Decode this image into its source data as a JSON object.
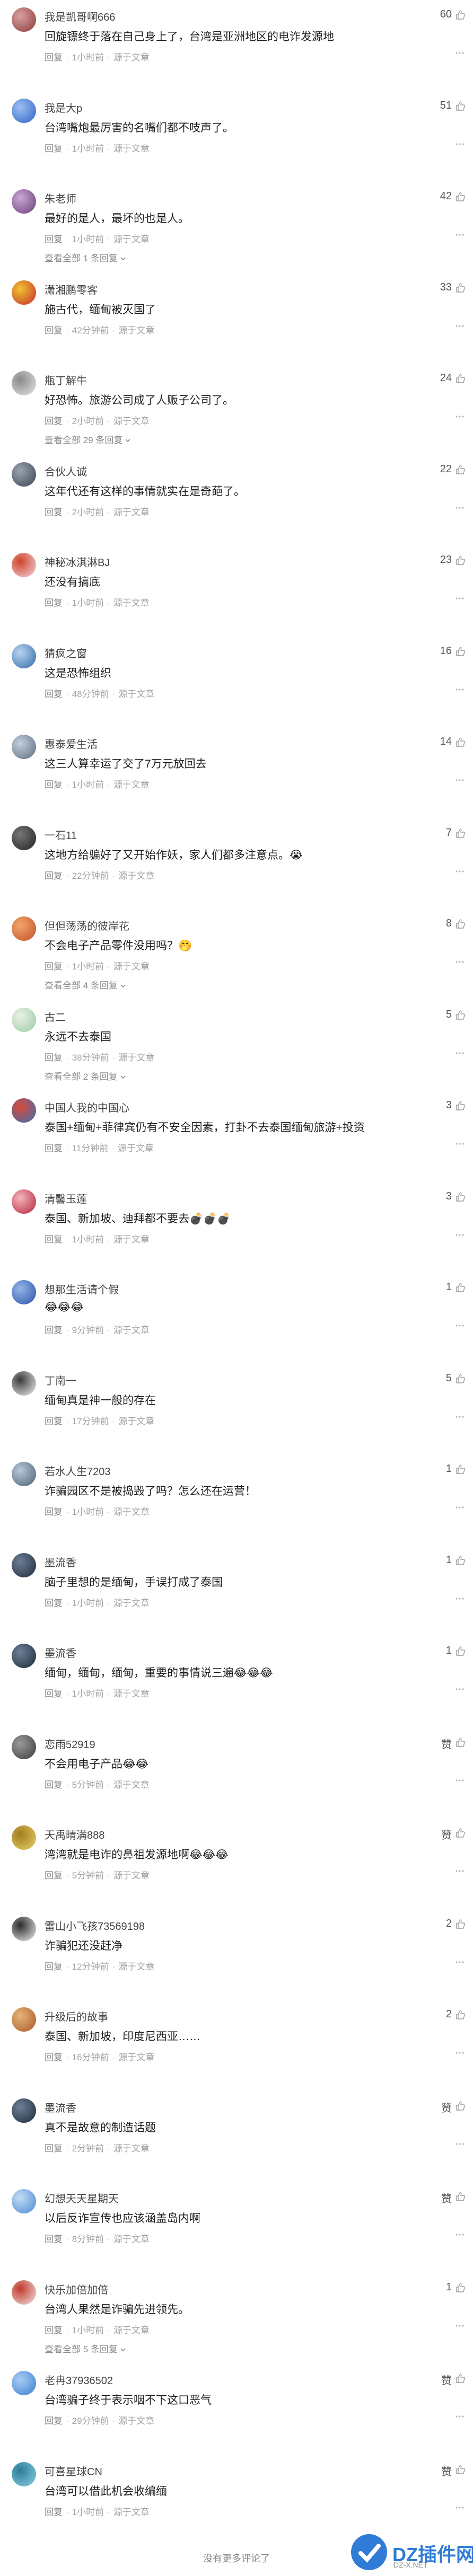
{
  "comments": [
    {
      "name": "我是凯哥啊666",
      "text": "回旋镖终于落在自己身上了，台湾是亚洲地区的电诈发源地",
      "time": "1小时前",
      "source": "源于文章",
      "likes": "60",
      "sub": "",
      "colors": [
        "#8b3a3a",
        "#d9a0a0"
      ]
    },
    {
      "name": "我是大p",
      "text": "台湾嘴炮最厉害的名嘴们都不吱声了。",
      "time": "1小时前",
      "source": "源于文章",
      "likes": "51",
      "sub": "",
      "colors": [
        "#2f63c8",
        "#9cc0f2"
      ]
    },
    {
      "name": "朱老师",
      "text": "最好的是人，最坏的也是人。",
      "time": "1小时前",
      "source": "源于文章",
      "likes": "42",
      "sub": "查看全部 1 条回复",
      "colors": [
        "#6b3f78",
        "#c9a7d6"
      ]
    },
    {
      "name": "潇湘鹏零客",
      "text": "施古代，缅甸被灭国了",
      "time": "42分钟前",
      "source": "源于文章",
      "likes": "33",
      "sub": "",
      "colors": [
        "#c62d2d",
        "#f1c232"
      ]
    },
    {
      "name": "瓶丁解牛",
      "text": "好恐怖。旅游公司成了人贩子公司了。",
      "time": "2小时前",
      "source": "源于文章",
      "likes": "24",
      "sub": "查看全部 29 条回复",
      "colors": [
        "#e6e6e6",
        "#8a8a8a"
      ]
    },
    {
      "name": "合伙人诚",
      "text": "这年代还有这样的事情就实在是奇葩了。",
      "time": "2小时前",
      "source": "源于文章",
      "likes": "22",
      "sub": "",
      "colors": [
        "#3b4454",
        "#9aa3b0"
      ]
    },
    {
      "name": "神秘冰淇淋BJ",
      "text": "还没有搞底",
      "time": "1小时前",
      "source": "源于文章",
      "likes": "23",
      "sub": "",
      "colors": [
        "#f0d8e0",
        "#d1432a"
      ]
    },
    {
      "name": "猜疯之窗",
      "text": "这是恐怖组织",
      "time": "48分钟前",
      "source": "源于文章",
      "likes": "16",
      "sub": "",
      "colors": [
        "#2e6ba8",
        "#b9d4ee"
      ]
    },
    {
      "name": "惠泰爱生活",
      "text": "这三人算幸运了交了7万元放回去",
      "time": "1小时前",
      "source": "源于文章",
      "likes": "14",
      "sub": "",
      "colors": [
        "#5a6a80",
        "#c4d0dc"
      ]
    },
    {
      "name": "一石11",
      "text": "这地方给骗好了又开始作妖，家人们都多注意点。😭",
      "time": "22分钟前",
      "source": "源于文章",
      "likes": "7",
      "sub": "",
      "colors": [
        "#222222",
        "#777777"
      ]
    },
    {
      "name": "但但荡荡的彼岸花",
      "text": "不会电子产品零件没用吗？🤭",
      "time": "1小时前",
      "source": "源于文章",
      "likes": "8",
      "sub": "查看全部 4 条回复",
      "colors": [
        "#c0502a",
        "#f3a66b"
      ]
    },
    {
      "name": "古二",
      "text": "永远不去泰国",
      "time": "38分钟前",
      "source": "源于文章",
      "likes": "5",
      "sub": "查看全部 2 条回复",
      "colors": [
        "#9dc9a0",
        "#e7f2e5"
      ]
    },
    {
      "name": "中国人我的中国心",
      "text": "泰国+缅甸+菲律宾仍有不安全因素，打卦不去泰国缅甸旅游+投资",
      "time": "11分钟前",
      "source": "源于文章",
      "likes": "3",
      "sub": "",
      "colors": [
        "#3b6fb0",
        "#d94a3a"
      ]
    },
    {
      "name": "清馨玉莲",
      "text": "泰国、新加坡、迪拜都不要去💣💣💣",
      "time": "1小时前",
      "source": "源于文章",
      "likes": "3",
      "sub": "",
      "colors": [
        "#b5263a",
        "#f3b4bc"
      ]
    },
    {
      "name": "想那生活请个假",
      "text": "😂😂😂",
      "time": "9分钟前",
      "source": "源于文章",
      "likes": "1",
      "sub": "",
      "colors": [
        "#2a53a8",
        "#96b4e8"
      ]
    },
    {
      "name": "丁南一",
      "text": "缅甸真是神一般的存在",
      "time": "17分钟前",
      "source": "源于文章",
      "likes": "5",
      "sub": "",
      "colors": [
        "#f4f4f4",
        "#3a3a3a"
      ]
    },
    {
      "name": "若水人生7203",
      "text": "诈骗园区不是被捣毁了吗？怎么还在运营！",
      "time": "1小时前",
      "source": "源于文章",
      "likes": "1",
      "sub": "",
      "colors": [
        "#4a6078",
        "#b9c7d6"
      ]
    },
    {
      "name": "墨流香",
      "text": "脑子里想的是缅甸，手误打成了泰国",
      "time": "1小时前",
      "source": "源于文章",
      "likes": "1",
      "sub": "",
      "colors": [
        "#1f2a3a",
        "#6d7f95"
      ]
    },
    {
      "name": "墨流香",
      "text": "缅甸，缅甸，缅甸，重要的事情说三遍😂😂😂",
      "time": "1小时前",
      "source": "源于文章",
      "likes": "1",
      "sub": "",
      "colors": [
        "#1f2a3a",
        "#6d7f95"
      ]
    },
    {
      "name": "恋雨52919",
      "text": "不会用电子产品😂😂",
      "time": "5分钟前",
      "source": "源于文章",
      "likes": "赞",
      "sub": "",
      "colors": [
        "#3a3a3a",
        "#9a9a9a"
      ]
    },
    {
      "name": "天禹晴满888",
      "text": "湾湾就是电诈的鼻祖发源地啊😂😂😂",
      "time": "5分钟前",
      "source": "源于文章",
      "likes": "赞",
      "sub": "",
      "colors": [
        "#e8d36a",
        "#a27b20"
      ]
    },
    {
      "name": "雷山小飞孩73569198",
      "text": "诈骗犯还没赶净",
      "time": "12分钟前",
      "source": "源于文章",
      "likes": "2",
      "sub": "",
      "colors": [
        "#f2f2f2",
        "#2b2b2b"
      ]
    },
    {
      "name": "升级后的故事",
      "text": "泰国、新加坡，印度尼西亚……",
      "time": "16分钟前",
      "source": "源于文章",
      "likes": "2",
      "sub": "",
      "colors": [
        "#a85a2a",
        "#e8b27a"
      ]
    },
    {
      "name": "墨流香",
      "text": "真不是故意的制造话题",
      "time": "2分钟前",
      "source": "源于文章",
      "likes": "赞",
      "sub": "",
      "colors": [
        "#1f2a3a",
        "#6d7f95"
      ]
    },
    {
      "name": "幻想天天星期天",
      "text": "以后反诈宣传也应该涵盖岛内啊",
      "time": "8分钟前",
      "source": "源于文章",
      "likes": "赞",
      "sub": "",
      "colors": [
        "#4a8ad4",
        "#c4dcf4"
      ]
    },
    {
      "name": "快乐加倍加倍",
      "text": "台湾人果然是诈骗先进领先。",
      "time": "1小时前",
      "source": "源于文章",
      "likes": "1",
      "sub": "查看全部 5 条回复",
      "colors": [
        "#f3e5e5",
        "#c0392b"
      ]
    },
    {
      "name": "老冉37936502",
      "text": "台湾骗子终于表示咽不下这口恶气",
      "time": "29分钟前",
      "source": "源于文章",
      "likes": "赞",
      "sub": "",
      "colors": [
        "#3a7fd0",
        "#a9cdf3"
      ]
    },
    {
      "name": "可喜星球CN",
      "text": "台湾可以借此机会收编缅",
      "time": "1小时前",
      "source": "源于文章",
      "likes": "赞",
      "sub": "",
      "colors": [
        "#8fd0e0",
        "#2b7c9a"
      ]
    }
  ],
  "labels": {
    "reply": "回复",
    "sep": "·"
  },
  "footer": "没有更多评论了",
  "watermark": {
    "title": "DZ插件网",
    "sub": "DZ-X.NET"
  }
}
